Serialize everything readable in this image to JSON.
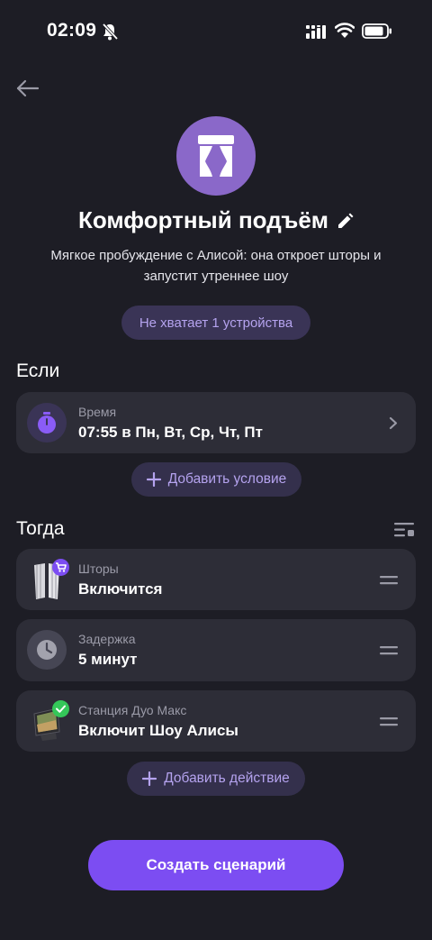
{
  "status_bar": {
    "time": "02:09"
  },
  "header": {
    "title": "Комфортный подъём",
    "description": "Мягкое пробуждение с Алисой: она откроет шторы и запустит утреннее шоу",
    "missing_badge": "Не хватает 1 устройства"
  },
  "if_section": {
    "title": "Если",
    "condition": {
      "label": "Время",
      "value": "07:55 в Пн, Вт, Ср, Чт, Пт"
    },
    "add_label": "Добавить условие"
  },
  "then_section": {
    "title": "Тогда",
    "actions": [
      {
        "label": "Шторы",
        "value": "Включится"
      },
      {
        "label": "Задержка",
        "value": "5 минут"
      },
      {
        "label": "Станция Дуо Макс",
        "value": "Включит Шоу Алисы"
      }
    ],
    "add_label": "Добавить действие"
  },
  "create_button": "Создать сценарий",
  "colors": {
    "accent": "#7c4df2",
    "pill_text": "#b5a3ef",
    "card_bg": "#2d2d37",
    "bg": "#1d1d25",
    "success": "#34c759"
  }
}
